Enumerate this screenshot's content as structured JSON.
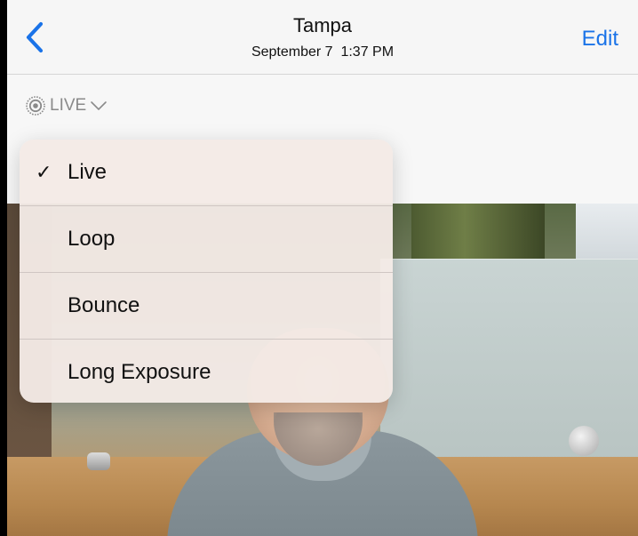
{
  "nav": {
    "title": "Tampa",
    "subtitle": "September 7  1:37 PM",
    "edit_label": "Edit",
    "accent": "#1a73e8"
  },
  "live_badge": {
    "label": "LIVE",
    "icon": "live-photo-icon",
    "chevron": "chevron-down-icon"
  },
  "menu": {
    "items": [
      {
        "label": "Live",
        "checked": "✓"
      },
      {
        "label": "Loop",
        "checked": ""
      },
      {
        "label": "Bounce",
        "checked": ""
      },
      {
        "label": "Long Exposure",
        "checked": ""
      }
    ]
  }
}
